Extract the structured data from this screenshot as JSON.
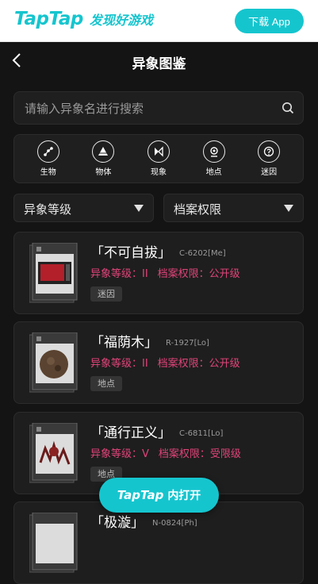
{
  "topbar": {
    "brand": "TapTap",
    "slogan": "发现好游戏",
    "download_label": "下载 App"
  },
  "header": {
    "title": "异象图鉴"
  },
  "search": {
    "placeholder": "请输入异象名进行搜索"
  },
  "categories": [
    {
      "label": "生物",
      "icon": "biology-icon"
    },
    {
      "label": "物体",
      "icon": "object-icon"
    },
    {
      "label": "现象",
      "icon": "phenomenon-icon"
    },
    {
      "label": "地点",
      "icon": "location-icon"
    },
    {
      "label": "迷因",
      "icon": "meme-icon"
    }
  ],
  "filters": {
    "level_label": "异象等级",
    "permission_label": "档案权限"
  },
  "cards": [
    {
      "name": "「不可自拔」",
      "code": "C-6202[Me]",
      "level": "异象等级：II",
      "permission": "档案权限：公开级",
      "tag": "迷因"
    },
    {
      "name": "「福荫木」",
      "code": "R-1927[Lo]",
      "level": "异象等级：II",
      "permission": "档案权限：公开级",
      "tag": "地点"
    },
    {
      "name": "「通行正义」",
      "code": "C-6811[Lo]",
      "level": "异象等级：V",
      "permission": "档案权限：受限级",
      "tag": "地点"
    },
    {
      "name": "「极漩」",
      "code": "N-0824[Ph]"
    }
  ],
  "open_app": {
    "brand": "TapTap",
    "label": "内打开"
  },
  "colors": {
    "accent": "#15c5ce",
    "meta": "#e0447a",
    "background": "#141414"
  }
}
